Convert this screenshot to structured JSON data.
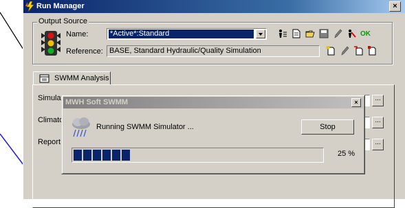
{
  "window": {
    "title": "Run Manager",
    "close_glyph": "×"
  },
  "output_source": {
    "legend": "Output Source",
    "name_label": "Name:",
    "name_value": "*Active*:Standard",
    "reference_label": "Reference:",
    "reference_value": "BASE, Standard Hydraulic/Quality Simulation",
    "ok_label": "OK"
  },
  "tabs": [
    {
      "label": "SWMM Analysis"
    }
  ],
  "rows": [
    {
      "label": "Simulat"
    },
    {
      "label": "Climato"
    },
    {
      "label": "Report"
    }
  ],
  "dots_label": "...",
  "progress_dialog": {
    "title": "MWH Soft SWMM",
    "close_glyph": "×",
    "message": "Running SWMM Simulator ...",
    "stop_label": "Stop",
    "percent_text": "25 %",
    "progress": 0.25
  },
  "icons": [
    "traffic-light-icon",
    "storm-cloud-icon",
    "swmm-tab-icon"
  ],
  "colors": {
    "title_active": "#0a246a",
    "selection": "#0a246a",
    "window_bg": "#d4d0c8",
    "progress": "#0a246a"
  }
}
